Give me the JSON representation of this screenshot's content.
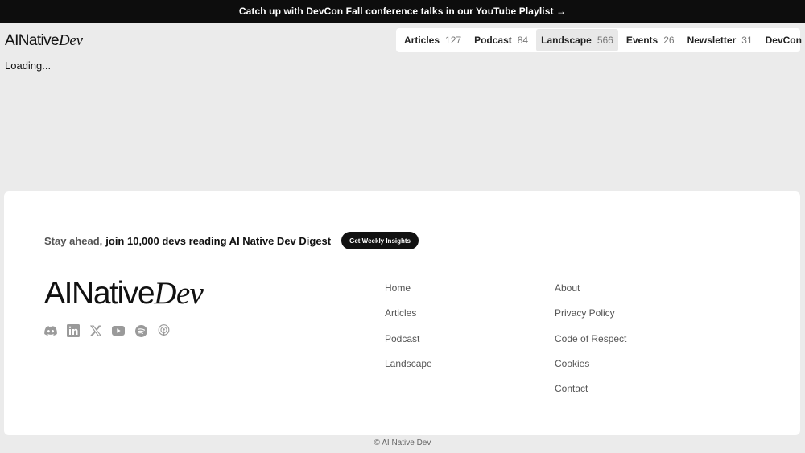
{
  "banner": {
    "text": "Catch up with DevCon Fall conference talks in our YouTube Playlist →"
  },
  "logo": {
    "left": "AINative",
    "right": "Dev"
  },
  "nav": {
    "items": [
      {
        "label": "Articles",
        "count": "127",
        "active": false
      },
      {
        "label": "Podcast",
        "count": "84",
        "active": false
      },
      {
        "label": "Landscape",
        "count": "566",
        "active": true
      },
      {
        "label": "Events",
        "count": "26",
        "active": false
      },
      {
        "label": "Newsletter",
        "count": "31",
        "active": false
      },
      {
        "label": "DevCon",
        "count": "",
        "active": false
      }
    ]
  },
  "main": {
    "loading_text": "Loading..."
  },
  "footer": {
    "digest": {
      "muted": "Stay ahead,",
      "strong": "join 10,000 devs reading AI Native Dev Digest",
      "cta": "Get Weekly Insights"
    },
    "social": [
      "discord-icon",
      "linkedin-icon",
      "x-icon",
      "youtube-icon",
      "spotify-icon",
      "podcast-icon"
    ],
    "links_col1": [
      "Home",
      "Articles",
      "Podcast",
      "Landscape"
    ],
    "links_col2": [
      "About",
      "Privacy Policy",
      "Code of Respect",
      "Cookies",
      "Contact"
    ],
    "copyright": "© AI Native Dev"
  },
  "colors": {
    "banner_bg": "#0d0d0d",
    "page_bg": "#ebebeb",
    "icon_gray": "#9a9a9a"
  }
}
